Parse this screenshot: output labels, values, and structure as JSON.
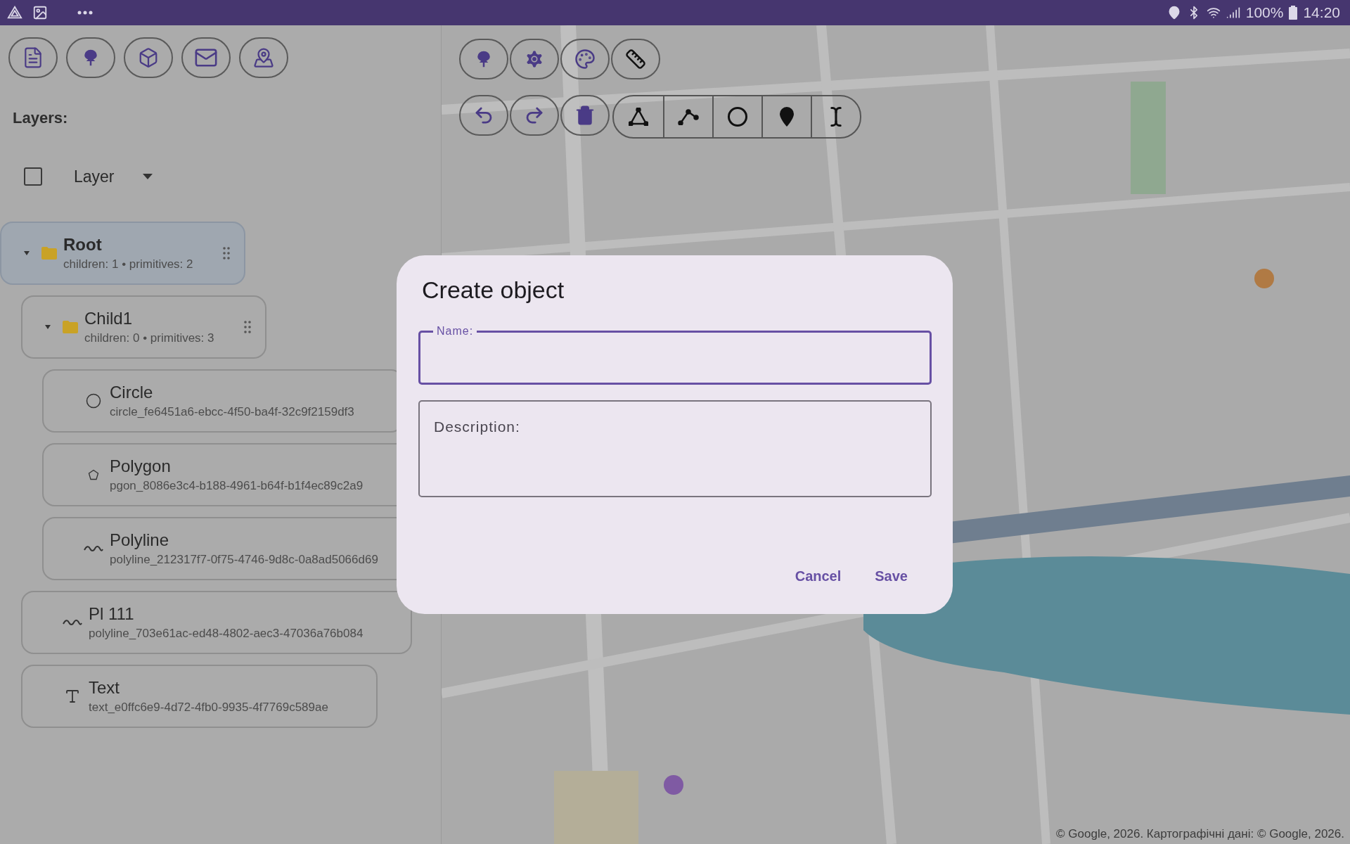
{
  "status_bar": {
    "battery": "100%",
    "time": "14:20"
  },
  "layers_panel": {
    "title": "Layers:",
    "visibility_checkbox": {
      "checked": false
    },
    "layer_select": {
      "value": "Layer"
    },
    "tree": [
      {
        "kind": "folder",
        "name": "Root",
        "details": "children: 1 • primitives: 2",
        "selected": true,
        "expanded": true,
        "children": [
          {
            "kind": "folder",
            "name": "Child1",
            "details": "children: 0 • primitives: 3",
            "selected": false,
            "expanded": true,
            "children": [
              {
                "kind": "circle",
                "name": "Circle",
                "details": "circle_fe6451a6-ebcc-4f50-ba4f-32c9f2159df3",
                "selected": false
              },
              {
                "kind": "polygon",
                "name": "Polygon",
                "details": "pgon_8086e3c4-b188-4961-b64f-b1f4ec89c2a9",
                "selected": false
              },
              {
                "kind": "polyline",
                "name": "Polyline",
                "details": "polyline_212317f7-0f75-4746-9d8c-0a8ad5066d69",
                "selected": false
              }
            ]
          },
          {
            "kind": "polyline",
            "name": "Pl 111",
            "details": "polyline_703e61ac-ed48-4802-aec3-47036a76b084",
            "selected": false
          },
          {
            "kind": "text",
            "name": "Text",
            "details": "text_e0ffc6e9-4d72-4fb0-9935-4f7769c589ae",
            "selected": false
          }
        ]
      }
    ]
  },
  "map": {
    "attribution": "© Google, 2026. Картографічні дані: © Google, 2026."
  },
  "dialog": {
    "title": "Create object",
    "fields": [
      {
        "label": "Name:",
        "focused": true
      },
      {
        "label": "Description:",
        "focused": false
      }
    ],
    "buttons": [
      "Cancel",
      "Save"
    ]
  }
}
